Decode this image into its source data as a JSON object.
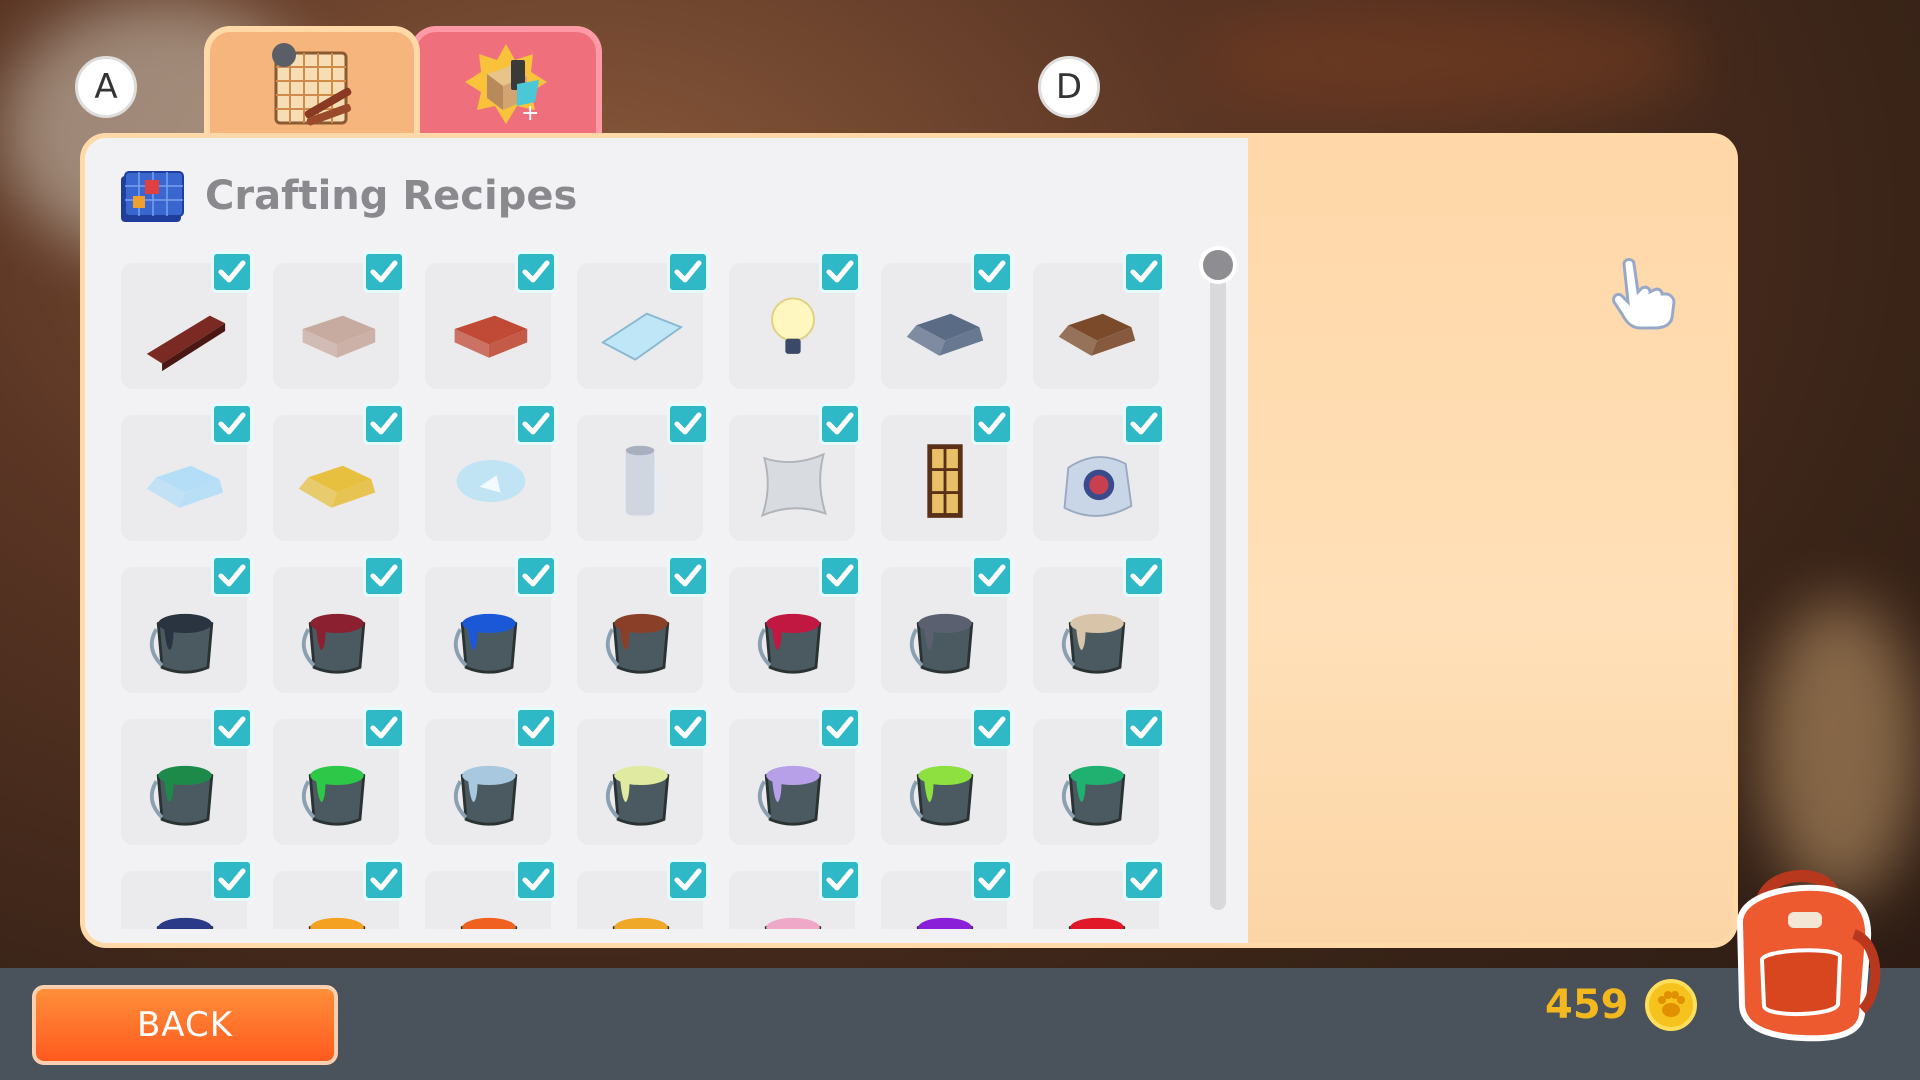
{
  "hints": {
    "left": "A",
    "right": "D"
  },
  "tabs": [
    {
      "name": "recipes-tab",
      "icon": "blueprint-icon",
      "active": true
    },
    {
      "name": "unlocks-tab",
      "icon": "box-unlock-icon",
      "active": false
    }
  ],
  "panel": {
    "title": "Crafting Recipes",
    "title_icon": "blueprint-map-icon"
  },
  "recipes": {
    "rows": [
      [
        {
          "kind": "plank",
          "color": "#7a2a22"
        },
        {
          "kind": "bar",
          "color": "#c8aba0"
        },
        {
          "kind": "bar",
          "color": "#c04a35"
        },
        {
          "kind": "tile",
          "color": "#bfe6f7"
        },
        {
          "kind": "bulb",
          "color": "#fff6c0"
        },
        {
          "kind": "ingot",
          "color": "#5a6b85"
        },
        {
          "kind": "ingot",
          "color": "#7a4a2a"
        }
      ],
      [
        {
          "kind": "ingot",
          "color": "#b4def7"
        },
        {
          "kind": "ingot",
          "color": "#e7c040"
        },
        {
          "kind": "glass",
          "color": "#bde3f5"
        },
        {
          "kind": "paper",
          "color": "#d0d6e0"
        },
        {
          "kind": "cloth",
          "color": "#d8dce0"
        },
        {
          "kind": "lantern",
          "color": "#e8c068"
        },
        {
          "kind": "sack",
          "color": "#c8d6e8"
        }
      ],
      [
        {
          "kind": "paint",
          "color": "#2a3440"
        },
        {
          "kind": "paint",
          "color": "#8a2030"
        },
        {
          "kind": "paint",
          "color": "#1a58d8"
        },
        {
          "kind": "paint",
          "color": "#8a4028"
        },
        {
          "kind": "paint",
          "color": "#c01840"
        },
        {
          "kind": "paint",
          "color": "#5a6070"
        },
        {
          "kind": "paint",
          "color": "#d8c4a8"
        }
      ],
      [
        {
          "kind": "paint",
          "color": "#1e8a4a"
        },
        {
          "kind": "paint",
          "color": "#2ec848"
        },
        {
          "kind": "paint",
          "color": "#a8c8e0"
        },
        {
          "kind": "paint",
          "color": "#e0eaa0"
        },
        {
          "kind": "paint",
          "color": "#b8a0e8"
        },
        {
          "kind": "paint",
          "color": "#8ee040"
        },
        {
          "kind": "paint",
          "color": "#20b070"
        }
      ],
      [
        {
          "kind": "paint",
          "color": "#2a3a88"
        },
        {
          "kind": "paint",
          "color": "#f4a020"
        },
        {
          "kind": "paint",
          "color": "#f06020"
        },
        {
          "kind": "paint",
          "color": "#f0a828"
        },
        {
          "kind": "paint",
          "color": "#f0a8c8"
        },
        {
          "kind": "paint",
          "color": "#8a20d8"
        },
        {
          "kind": "paint",
          "color": "#e01828"
        }
      ]
    ],
    "all_checked": true
  },
  "footer": {
    "back_label": "BACK",
    "coins": "459",
    "coin_icon": "paw-coin-icon",
    "backpack_icon": "backpack-icon"
  },
  "colors": {
    "accent_tab": "#f7b57e",
    "secondary_tab": "#ef6f7d",
    "check": "#2fb8c6",
    "back_button": "#ff6a28",
    "coins": "#f4b81f"
  }
}
